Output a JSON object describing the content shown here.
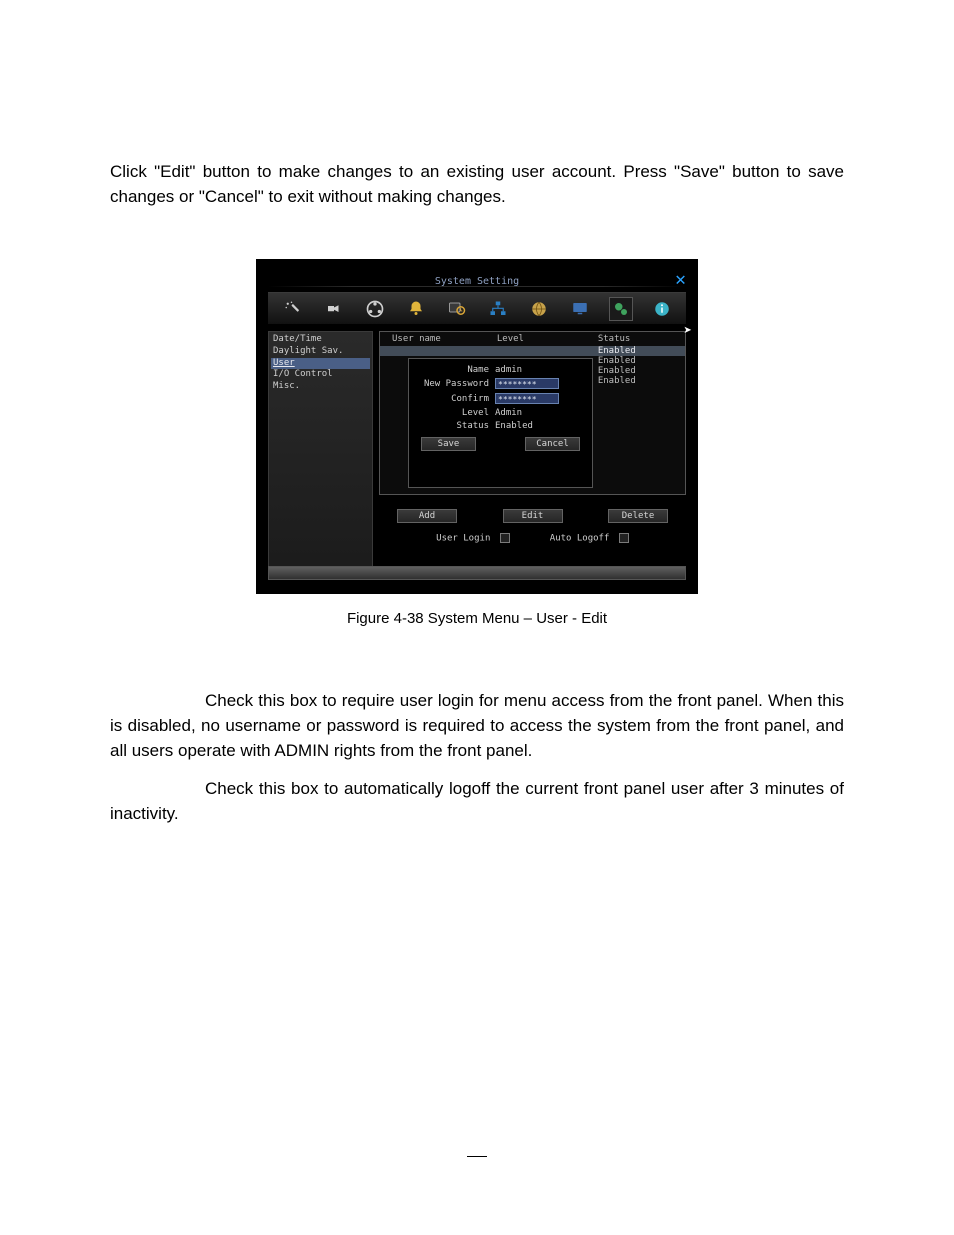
{
  "doc": {
    "para1": "Click \"Edit\" button to make changes to an existing user account. Press \"Save\" button to save changes or \"Cancel\" to exit without making changes.",
    "caption": "Figure 4-38 System Menu – User - Edit",
    "para2": "Check this box to require user login for menu access from the front panel. When this is disabled, no username or password is required to access the system from the front panel, and all users operate with ADMIN rights from the front panel.",
    "para3": "Check this box to automatically logoff the current front panel user after 3 minutes of inactivity."
  },
  "dvr": {
    "title": "System Setting",
    "nav": [
      {
        "label": "Date/Time"
      },
      {
        "label": "Daylight Sav."
      },
      {
        "label": "User",
        "selected": true
      },
      {
        "label": "I/O Control"
      },
      {
        "label": "Misc."
      }
    ],
    "list": {
      "headers": {
        "name": "User name",
        "level": "Level",
        "status": "Status"
      },
      "rows": [
        {
          "name": "",
          "level": "",
          "status": "Enabled",
          "selected": true
        },
        {
          "name": "",
          "level": "",
          "status": "Enabled"
        },
        {
          "name": "",
          "level": "",
          "status": "Enabled"
        },
        {
          "name": "",
          "level": "",
          "status": "Enabled"
        }
      ]
    },
    "form": {
      "name_label": "Name",
      "name_value": "admin",
      "newpw_label": "New Password",
      "newpw_value": "********",
      "confirm_label": "Confirm",
      "confirm_value": "********",
      "level_label": "Level",
      "level_value": "Admin",
      "status_label": "Status",
      "status_value": "Enabled",
      "save_label": "Save",
      "cancel_label": "Cancel"
    },
    "footer": {
      "add_label": "Add",
      "edit_label": "Edit",
      "delete_label": "Delete",
      "userlogin_label": "User Login",
      "autologoff_label": "Auto Logoff"
    }
  }
}
